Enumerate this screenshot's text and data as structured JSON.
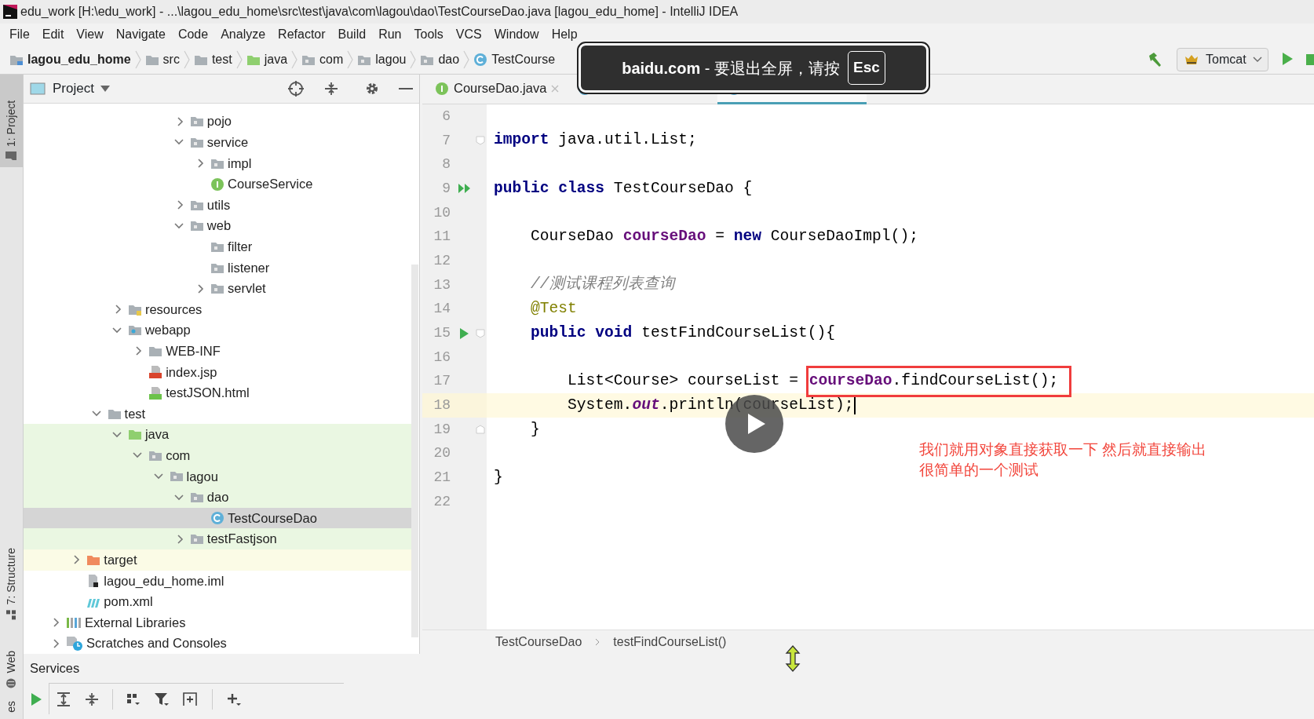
{
  "window": {
    "title": "edu_work [H:\\edu_work] - ...\\lagou_edu_home\\src\\test\\java\\com\\lagou\\dao\\TestCourseDao.java [lagou_edu_home] - IntelliJ IDEA"
  },
  "menu": [
    "File",
    "Edit",
    "View",
    "Navigate",
    "Code",
    "Analyze",
    "Refactor",
    "Build",
    "Run",
    "Tools",
    "VCS",
    "Window",
    "Help"
  ],
  "nav_bar": {
    "crumbs": [
      {
        "label": "lagou_edu_home",
        "kind": "module"
      },
      {
        "label": "src",
        "kind": "folder"
      },
      {
        "label": "test",
        "kind": "folder"
      },
      {
        "label": "java",
        "kind": "test_root"
      },
      {
        "label": "com",
        "kind": "package"
      },
      {
        "label": "lagou",
        "kind": "package"
      },
      {
        "label": "dao",
        "kind": "package"
      },
      {
        "label": "TestCourse",
        "kind": "class"
      }
    ],
    "run_config": "Tomcat"
  },
  "side_strip": {
    "top": [
      {
        "label": "1: Project",
        "kind": "project",
        "selected": true
      }
    ],
    "bottom": [
      {
        "label": "7: Structure",
        "kind": "structure",
        "selected": false
      },
      {
        "label": "Web",
        "kind": "web",
        "selected": false
      },
      {
        "label": "es",
        "kind": "none",
        "selected": false
      }
    ]
  },
  "project_panel": {
    "title": "Project",
    "tree": [
      {
        "children": [
          {
            "children": [
              {
                "children": [
                  {
                    "children": [
                      {
                        "children": [
                          {
                            "children": [
                              {
                                "label": "pojo",
                                "kind": "package",
                                "expanded": false,
                                "selected": false
                              },
                              {
                                "label": "service",
                                "kind": "package",
                                "expanded": true,
                                "selected": false,
                                "children": [
                                  {
                                    "label": "impl",
                                    "kind": "package",
                                    "expanded": false,
                                    "selected": false
                                  },
                                  {
                                    "label": "CourseService",
                                    "kind": "interface",
                                    "selected": false
                                  }
                                ]
                              },
                              {
                                "label": "utils",
                                "kind": "package",
                                "expanded": false,
                                "selected": false
                              },
                              {
                                "label": "web",
                                "kind": "package",
                                "expanded": true,
                                "selected": false,
                                "children": [
                                  {
                                    "label": "filter",
                                    "kind": "package",
                                    "selected": false
                                  },
                                  {
                                    "label": "listener",
                                    "kind": "package",
                                    "selected": false
                                  },
                                  {
                                    "label": "servlet",
                                    "kind": "package",
                                    "expanded": false,
                                    "selected": false
                                  }
                                ]
                              }
                            ]
                          }
                        ]
                      }
                    ]
                  },
                  {
                    "label": "resources",
                    "kind": "resources",
                    "expanded": false,
                    "selected": false
                  },
                  {
                    "label": "webapp",
                    "kind": "webapp",
                    "expanded": true,
                    "selected": false,
                    "children": [
                      {
                        "label": "WEB-INF",
                        "kind": "folder",
                        "expanded": false,
                        "selected": false
                      },
                      {
                        "label": "index.jsp",
                        "kind": "jsp",
                        "selected": false
                      },
                      {
                        "label": "testJSON.html",
                        "kind": "html",
                        "selected": false
                      }
                    ]
                  }
                ]
              },
              {
                "label": "test",
                "kind": "folder",
                "expanded": true,
                "selected": false,
                "children": [
                  {
                    "label": "java",
                    "kind": "test_root",
                    "expanded": true,
                    "selected": false,
                    "test_source": true,
                    "children": [
                      {
                        "label": "com",
                        "kind": "package",
                        "expanded": true,
                        "selected": false,
                        "test_source": true,
                        "children": [
                          {
                            "label": "lagou",
                            "kind": "package",
                            "expanded": true,
                            "selected": false,
                            "test_source": true,
                            "children": [
                              {
                                "label": "dao",
                                "kind": "package",
                                "expanded": true,
                                "selected": false,
                                "test_source": true,
                                "children": [
                                  {
                                    "label": "TestCourseDao",
                                    "kind": "class",
                                    "selected": true
                                  }
                                ]
                              },
                              {
                                "label": "testFastjson",
                                "kind": "package",
                                "expanded": false,
                                "selected": false,
                                "test_source": true
                              }
                            ]
                          }
                        ]
                      }
                    ]
                  }
                ]
              }
            ]
          },
          {
            "label": "target",
            "kind": "target",
            "expanded": false,
            "selected": false,
            "excluded": true
          },
          {
            "label": "lagou_edu_home.iml",
            "kind": "iml",
            "selected": false
          },
          {
            "label": "pom.xml",
            "kind": "pom",
            "selected": false
          }
        ]
      },
      {
        "label": "External Libraries",
        "kind": "libraries",
        "expanded": false,
        "selected": false
      },
      {
        "label": "Scratches and Consoles",
        "kind": "scratches",
        "expanded": false,
        "selected": false
      }
    ]
  },
  "editor": {
    "tabs": [
      {
        "label": "CourseDao.java",
        "kind": "interface",
        "selected": false
      },
      {
        "kind": "class",
        "selected": false
      },
      {
        "kind": "class",
        "selected": true
      }
    ],
    "lines": [
      {
        "number": "6",
        "current": false
      },
      {
        "number": "7",
        "current": false,
        "fold_start": true,
        "tokens": [
          {
            "text": "import",
            "kind": "keyword"
          },
          {
            "text": " java.util.List;",
            "kind": "plain"
          }
        ]
      },
      {
        "number": "8",
        "current": false
      },
      {
        "number": "9",
        "current": false,
        "run_all": true,
        "tokens": [
          {
            "text": "public class",
            "kind": "keyword"
          },
          {
            "text": " TestCourseDao {",
            "kind": "plain"
          }
        ]
      },
      {
        "number": "10",
        "current": false
      },
      {
        "number": "11",
        "current": false,
        "tokens": [
          {
            "text": "    CourseDao ",
            "kind": "plain"
          },
          {
            "text": "courseDao",
            "kind": "field"
          },
          {
            "text": " = ",
            "kind": "plain"
          },
          {
            "text": "new",
            "kind": "keyword"
          },
          {
            "text": " CourseDaoImpl();",
            "kind": "plain"
          }
        ]
      },
      {
        "number": "12",
        "current": false
      },
      {
        "number": "13",
        "current": false,
        "tokens": [
          {
            "text": "    //测试课程列表查询",
            "kind": "comment"
          }
        ]
      },
      {
        "number": "14",
        "current": false,
        "tokens": [
          {
            "text": "    @Test",
            "kind": "annotation"
          }
        ]
      },
      {
        "number": "15",
        "current": false,
        "run": true,
        "fold_start": true,
        "tokens": [
          {
            "text": "    public void",
            "kind": "keyword"
          },
          {
            "text": " testFindCourseList(){",
            "kind": "plain"
          }
        ]
      },
      {
        "number": "16",
        "current": false
      },
      {
        "number": "17",
        "current": false,
        "tokens": [
          {
            "text": "        List<Course> courseList = ",
            "kind": "plain"
          },
          {
            "text": "courseDao",
            "kind": "field",
            "boxed": true
          },
          {
            "text": ".findCourseList();",
            "kind": "plain",
            "boxed": true
          }
        ]
      },
      {
        "number": "18",
        "current": true,
        "caret": true,
        "tokens": [
          {
            "text": "        System.",
            "kind": "plain"
          },
          {
            "text": "out",
            "kind": "static"
          },
          {
            "text": ".println(courseList);",
            "kind": "plain"
          }
        ]
      },
      {
        "number": "19",
        "current": false,
        "fold_end": true,
        "tokens": [
          {
            "text": "    }",
            "kind": "plain"
          }
        ]
      },
      {
        "number": "20",
        "current": false
      },
      {
        "number": "21",
        "current": false,
        "tokens": [
          {
            "text": "}",
            "kind": "plain"
          }
        ]
      },
      {
        "number": "22",
        "current": false
      }
    ],
    "breadcrumb": [
      "TestCourseDao",
      "testFindCourseList()"
    ]
  },
  "services": {
    "title": "Services"
  },
  "overlay": {
    "toast": {
      "message": "**baidu.com**  -  要退出全屏，请按",
      "shortcut": "Esc"
    },
    "subtitle": [
      "我们就用对象直接获取一下 然后就直接输出",
      "很简单的一个测试"
    ]
  }
}
